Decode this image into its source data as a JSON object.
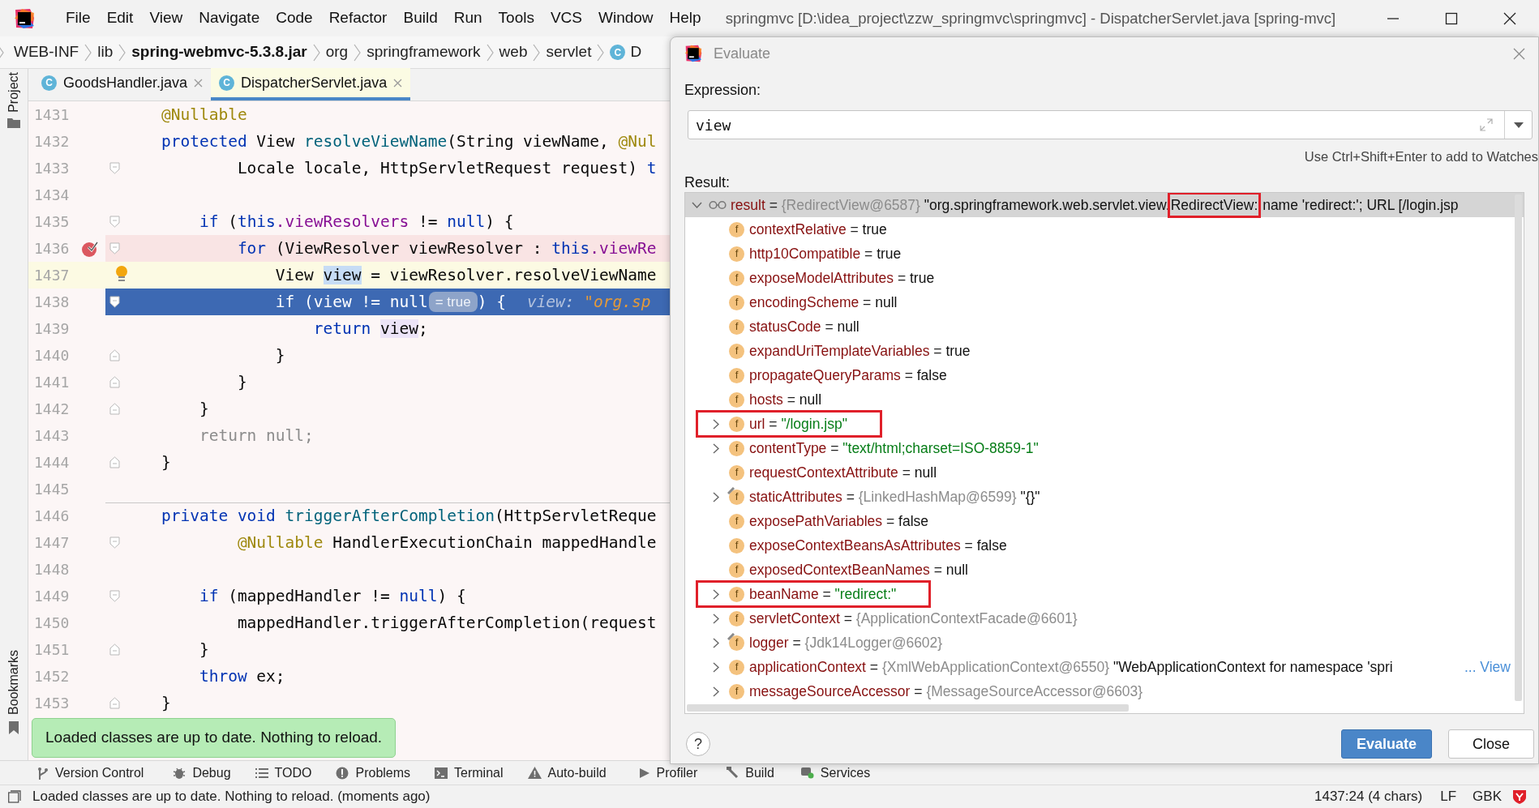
{
  "window": {
    "title": "springmvc [D:\\idea_project\\zzw_springmvc\\springmvc] - DispatcherServlet.java [spring-mvc]"
  },
  "menu": [
    "File",
    "Edit",
    "View",
    "Navigate",
    "Code",
    "Refactor",
    "Build",
    "Run",
    "Tools",
    "VCS",
    "Window",
    "Help"
  ],
  "breadcrumbs": [
    {
      "label": "WEB-INF",
      "kind": "folder"
    },
    {
      "label": "lib",
      "kind": "folder"
    },
    {
      "label": "spring-webmvc-5.3.8.jar",
      "kind": "archive"
    },
    {
      "label": "org",
      "kind": "folder"
    },
    {
      "label": "springframework",
      "kind": "folder"
    },
    {
      "label": "web",
      "kind": "folder"
    },
    {
      "label": "servlet",
      "kind": "folder"
    },
    {
      "label": "D",
      "kind": "class",
      "icon_letter": "C"
    }
  ],
  "side_tabs": {
    "top": "Project",
    "bottom": "Bookmarks"
  },
  "editor_tabs": [
    {
      "label": "GoodsHandler.java",
      "icon_letter": "C",
      "selected": false
    },
    {
      "label": "DispatcherServlet.java",
      "icon_letter": "C",
      "selected": true
    }
  ],
  "editor": {
    "lines": [
      {
        "number": "1431",
        "tokens": [
          {
            "t": "    @Nullable",
            "kind": "annotation"
          }
        ]
      },
      {
        "number": "1432",
        "tokens": [
          {
            "t": "    protected",
            "kind": "keyword"
          },
          {
            "t": " View ",
            "kind": "plain"
          },
          {
            "t": "resolveViewName",
            "kind": "method"
          },
          {
            "t": "(String viewName, ",
            "kind": "plain"
          },
          {
            "t": "@Nul",
            "kind": "annotation"
          }
        ]
      },
      {
        "number": "1433",
        "fold_start": true,
        "tokens": [
          {
            "t": "            Locale locale, HttpServletRequest request) ",
            "kind": "plain"
          },
          {
            "t": "t",
            "kind": "keyword"
          }
        ]
      },
      {
        "number": "1434"
      },
      {
        "number": "1435",
        "fold_start": true,
        "tokens": [
          {
            "t": "        if",
            "kind": "keyword"
          },
          {
            "t": " (",
            "kind": "plain"
          },
          {
            "t": "this",
            "kind": "keyword"
          },
          {
            "t": ".viewResolvers",
            "kind": "field"
          },
          {
            "t": " != ",
            "kind": "plain"
          },
          {
            "t": "null",
            "kind": "keyword"
          },
          {
            "t": ") {",
            "kind": "plain"
          }
        ]
      },
      {
        "number": "1436",
        "kind": "breakpoint",
        "fold_start": true,
        "tokens": [
          {
            "t": "            for",
            "kind": "keyword"
          },
          {
            "t": " (ViewResolver viewResolver : ",
            "kind": "plain"
          },
          {
            "t": "this",
            "kind": "keyword"
          },
          {
            "t": ".viewRe",
            "kind": "field"
          }
        ]
      },
      {
        "number": "1437",
        "kind": "caret",
        "intention_bulb": true,
        "tokens": [
          {
            "t": "                View ",
            "kind": "plain"
          },
          {
            "t": "view",
            "kind": "usage"
          },
          {
            "t": " = viewResolver.resolveViewName",
            "kind": "plain"
          }
        ]
      },
      {
        "number": "1438",
        "kind": "execution",
        "fold_start": true,
        "tokens": [
          {
            "t": "                if",
            "kind": "keyword"
          },
          {
            "t": " (view != ",
            "kind": "plain"
          },
          {
            "t": "null",
            "kind": "keyword"
          },
          {
            "t": "= true",
            "kind": "pill"
          },
          {
            "t": ") {",
            "kind": "plain"
          },
          {
            "t": "view: ",
            "kind": "hint"
          },
          {
            "t": "\"org.sp",
            "kind": "hint_value"
          }
        ]
      },
      {
        "number": "1439",
        "tokens": [
          {
            "t": "                    return ",
            "kind": "keyword"
          },
          {
            "t": "view",
            "kind": "usage_read"
          },
          {
            "t": ";",
            "kind": "plain"
          }
        ]
      },
      {
        "number": "1440",
        "fold_end": true,
        "tokens": [
          {
            "t": "                }",
            "kind": "plain"
          }
        ]
      },
      {
        "number": "1441",
        "fold_end": true,
        "tokens": [
          {
            "t": "            }",
            "kind": "plain"
          }
        ]
      },
      {
        "number": "1442",
        "fold_end": true,
        "tokens": [
          {
            "t": "        }",
            "kind": "plain"
          }
        ]
      },
      {
        "number": "1443",
        "tokens": [
          {
            "t": "        return null;",
            "kind": "dim"
          }
        ]
      },
      {
        "number": "1444",
        "fold_end": true,
        "tokens": [
          {
            "t": "    }",
            "kind": "plain"
          }
        ]
      },
      {
        "number": "1445"
      },
      {
        "number": "1446",
        "separator_above": true,
        "tokens": [
          {
            "t": "    private void ",
            "kind": "keyword"
          },
          {
            "t": "triggerAfterCompletion",
            "kind": "method"
          },
          {
            "t": "(HttpServletReque",
            "kind": "plain"
          }
        ]
      },
      {
        "number": "1447",
        "fold_start": true,
        "tokens": [
          {
            "t": "            @Nullable",
            "kind": "annotation"
          },
          {
            "t": " HandlerExecutionChain mappedHandle",
            "kind": "plain"
          }
        ]
      },
      {
        "number": "1448"
      },
      {
        "number": "1449",
        "fold_start": true,
        "tokens": [
          {
            "t": "        if",
            "kind": "keyword"
          },
          {
            "t": " (mappedHandler != ",
            "kind": "plain"
          },
          {
            "t": "null",
            "kind": "keyword"
          },
          {
            "t": ") {",
            "kind": "plain"
          }
        ]
      },
      {
        "number": "1450",
        "tokens": [
          {
            "t": "            mappedHandler.triggerAfterCompletion(request",
            "kind": "plain"
          }
        ]
      },
      {
        "number": "1451",
        "fold_end": true,
        "tokens": [
          {
            "t": "        }",
            "kind": "plain"
          }
        ]
      },
      {
        "number": "1452",
        "tokens": [
          {
            "t": "        throw",
            "kind": "keyword"
          },
          {
            "t": " ex;",
            "kind": "plain"
          }
        ]
      },
      {
        "number": "1453",
        "fold_end": true,
        "tokens": [
          {
            "t": "    }",
            "kind": "plain"
          }
        ]
      }
    ]
  },
  "notification": {
    "text": "Loaded classes are up to date. Nothing to reload."
  },
  "tool_windows": [
    {
      "label": "Version Control",
      "kind": "vcs"
    },
    {
      "label": "Debug",
      "kind": "debug"
    },
    {
      "label": "TODO",
      "kind": "todo"
    },
    {
      "label": "Problems",
      "kind": "problems"
    },
    {
      "label": "Terminal",
      "kind": "terminal"
    },
    {
      "label": "Auto-build",
      "kind": "autobuild"
    },
    {
      "label": "Profiler",
      "kind": "profiler"
    },
    {
      "label": "Build",
      "kind": "build"
    },
    {
      "label": "Services",
      "kind": "services"
    }
  ],
  "status_bar": {
    "message": "Loaded classes are up to date. Nothing to reload. (moments ago)",
    "position": "1437:24 (4 chars)",
    "line_separator": "LF",
    "encoding": "GBK"
  },
  "evaluate_dialog": {
    "title": "Evaluate",
    "expression_label": "Expression:",
    "expression": "view",
    "hint": "Use Ctrl+Shift+Enter to add to Watches",
    "result_label": "Result:",
    "result": {
      "name": "result",
      "operator": "=",
      "type": "{RedirectView@6587}",
      "expanded": true,
      "selected": true,
      "value_parts": [
        {
          "text": "\"org.springframework.web.servlet.view.",
          "boxed": false
        },
        {
          "text": "RedirectView:",
          "boxed": true
        },
        {
          "text": " name 'redirect:'; URL [/login.jsp",
          "boxed": false
        }
      ]
    },
    "fields": [
      {
        "icon_letter": "f",
        "name": "contextRelative",
        "operator": "=",
        "value": "true",
        "kind": "literal",
        "expandable": false
      },
      {
        "icon_letter": "f",
        "name": "http10Compatible",
        "operator": "=",
        "value": "true",
        "kind": "literal",
        "expandable": false
      },
      {
        "icon_letter": "f",
        "name": "exposeModelAttributes",
        "operator": "=",
        "value": "true",
        "kind": "literal",
        "expandable": false
      },
      {
        "icon_letter": "f",
        "name": "encodingScheme",
        "operator": "=",
        "value": "null",
        "kind": "literal",
        "expandable": false
      },
      {
        "icon_letter": "f",
        "name": "statusCode",
        "operator": "=",
        "value": "null",
        "kind": "literal",
        "expandable": false
      },
      {
        "icon_letter": "f",
        "name": "expandUriTemplateVariables",
        "operator": "=",
        "value": "true",
        "kind": "literal",
        "expandable": false
      },
      {
        "icon_letter": "f",
        "name": "propagateQueryParams",
        "operator": "=",
        "value": "false",
        "kind": "literal",
        "expandable": false
      },
      {
        "icon_letter": "f",
        "name": "hosts",
        "operator": "=",
        "value": "null",
        "kind": "literal",
        "expandable": false
      },
      {
        "icon_letter": "f",
        "name": "url",
        "operator": "=",
        "value": "\"/login.jsp\"",
        "kind": "string",
        "expandable": true,
        "boxed": true
      },
      {
        "icon_letter": "f",
        "name": "contentType",
        "operator": "=",
        "value": "\"text/html;charset=ISO-8859-1\"",
        "kind": "string",
        "expandable": true
      },
      {
        "icon_letter": "f",
        "name": "requestContextAttribute",
        "operator": "=",
        "value": "null",
        "kind": "literal",
        "expandable": false
      },
      {
        "icon_letter": "f",
        "name": "staticAttributes",
        "operator": "=",
        "value": "{LinkedHashMap@6599}",
        "kind": "ref",
        "description": "\"{}\"",
        "expandable": true,
        "static": true
      },
      {
        "icon_letter": "f",
        "name": "exposePathVariables",
        "operator": "=",
        "value": "false",
        "kind": "literal",
        "expandable": false
      },
      {
        "icon_letter": "f",
        "name": "exposeContextBeansAsAttributes",
        "operator": "=",
        "value": "false",
        "kind": "literal",
        "expandable": false
      },
      {
        "icon_letter": "f",
        "name": "exposedContextBeanNames",
        "operator": "=",
        "value": "null",
        "kind": "literal",
        "expandable": false
      },
      {
        "icon_letter": "f",
        "name": "beanName",
        "operator": "=",
        "value": "\"redirect:\"",
        "kind": "string",
        "expandable": true,
        "boxed": true
      },
      {
        "icon_letter": "f",
        "name": "servletContext",
        "operator": "=",
        "value": "{ApplicationContextFacade@6601}",
        "kind": "ref",
        "expandable": true
      },
      {
        "icon_letter": "f",
        "name": "logger",
        "operator": "=",
        "value": "{Jdk14Logger@6602}",
        "kind": "ref",
        "expandable": true,
        "static": true
      },
      {
        "icon_letter": "f",
        "name": "applicationContext",
        "operator": "=",
        "value": "{XmlWebApplicationContext@6550}",
        "kind": "ref",
        "description": "\"WebApplicationContext for namespace 'spri",
        "link": "... View",
        "expandable": true
      },
      {
        "icon_letter": "f",
        "name": "messageSourceAccessor",
        "operator": "=",
        "value": "{MessageSourceAccessor@6603}",
        "kind": "ref",
        "expandable": true
      }
    ],
    "help": "?",
    "buttons": [
      {
        "label": "Evaluate",
        "kind": "primary"
      },
      {
        "label": "Close",
        "kind": "default"
      }
    ]
  }
}
